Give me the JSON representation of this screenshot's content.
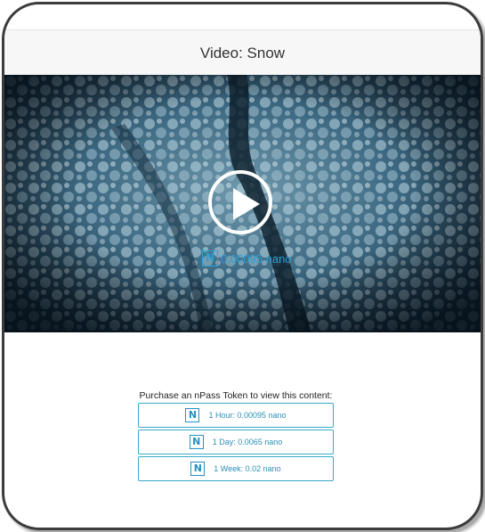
{
  "header": {
    "title": "Video: Snow"
  },
  "video": {
    "price_label": "0.00095 nano",
    "play_icon": "play-icon",
    "nano_icon": "nano-icon"
  },
  "purchase": {
    "title": "Purchase an nPass Token to view this content:",
    "options": [
      {
        "label": "1 Hour: 0.00095 nano"
      },
      {
        "label": "1 Day: 0.0065 nano"
      },
      {
        "label": "1 Week: 0.02 nano"
      }
    ]
  },
  "colors": {
    "accent": "#2aa1d6",
    "border": "#3aa9c9",
    "header_bg": "#f7f7f7"
  }
}
